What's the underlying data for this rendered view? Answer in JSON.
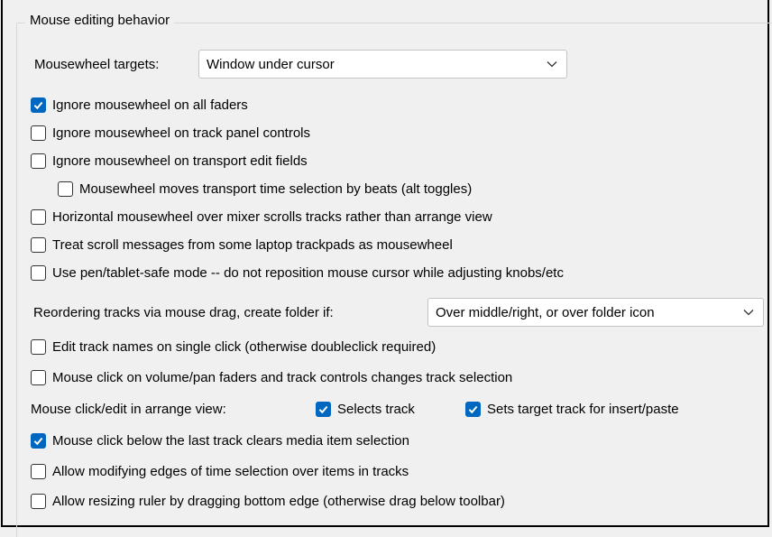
{
  "group": {
    "title": "Mouse editing behavior"
  },
  "mousewheel_targets": {
    "label": "Mousewheel targets:",
    "value": "Window under cursor"
  },
  "options": [
    {
      "label": "Ignore mousewheel on all faders",
      "checked": true
    },
    {
      "label": "Ignore mousewheel on track panel controls",
      "checked": false
    },
    {
      "label": "Ignore mousewheel on transport edit fields",
      "checked": false
    },
    {
      "label": "Mousewheel moves transport time selection by beats (alt toggles)",
      "checked": false
    },
    {
      "label": "Horizontal mousewheel over mixer scrolls tracks rather than arrange view",
      "checked": false
    },
    {
      "label": "Treat scroll messages from some laptop trackpads as mousewheel",
      "checked": false
    },
    {
      "label": "Use pen/tablet-safe mode -- do not reposition mouse cursor while adjusting knobs/etc",
      "checked": false
    }
  ],
  "reorder": {
    "label": "Reordering tracks via mouse drag, create folder if:",
    "value": "Over middle/right, or over folder icon"
  },
  "options2": [
    {
      "label": "Edit track names on single click (otherwise doubleclick required)",
      "checked": false
    },
    {
      "label": "Mouse click on volume/pan faders and track controls changes track selection",
      "checked": false
    }
  ],
  "arrange_click": {
    "label": "Mouse click/edit in arrange view:",
    "selects_track": {
      "label": "Selects track",
      "checked": true
    },
    "sets_target": {
      "label": "Sets target track for insert/paste",
      "checked": true
    }
  },
  "options3": [
    {
      "label": "Mouse click below the last track clears media item selection",
      "checked": true
    },
    {
      "label": "Allow modifying edges of time selection over items in tracks",
      "checked": false
    },
    {
      "label": "Allow resizing ruler by dragging bottom edge (otherwise drag below toolbar)",
      "checked": false
    }
  ]
}
